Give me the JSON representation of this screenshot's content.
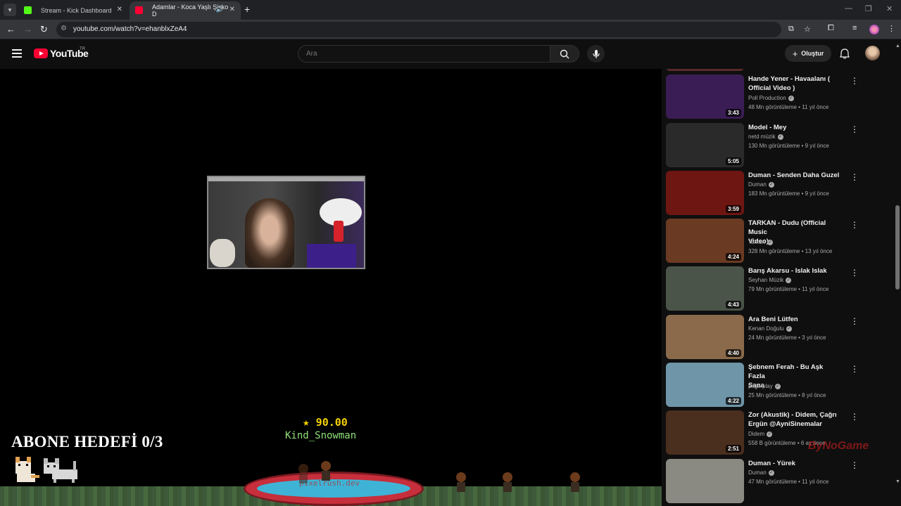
{
  "browser": {
    "tabs": [
      {
        "title": "Stream - Kick Dashboard"
      },
      {
        "title": "Adamlar - Koca Yaşlı Şişko D"
      }
    ],
    "url": "youtube.com/watch?v=ehanblxZeA4"
  },
  "masthead": {
    "logo_text": "YouTube",
    "country_code": "TR",
    "search_placeholder": "Ara",
    "create_label": "Oluştur"
  },
  "stream": {
    "subscriber_goal": "ABONE HEDEFİ 0/3",
    "donation_amount": "90.00",
    "donation_user": "Kind_Snowman",
    "pool_label": "pixelrush.dev"
  },
  "recommendations": [
    {
      "title_1": "Hande Yener - Havaalanı (",
      "title_2": "Official Video )",
      "channel": "Poll Production",
      "meta": "48 Mn görüntüleme • 11 yıl önce",
      "duration": "3:43",
      "thumb_color": "#3a1d55"
    },
    {
      "title_1": "Model - Mey",
      "title_2": "",
      "channel": "netd müzik",
      "meta": "130 Mn görüntüleme • 9 yıl önce",
      "duration": "5:05",
      "thumb_color": "#2a2a2a"
    },
    {
      "title_1": "Duman - Senden Daha Guzel",
      "title_2": "",
      "channel": "Duman",
      "meta": "183 Mn görüntüleme • 9 yıl önce",
      "duration": "3:59",
      "thumb_color": "#6e1612"
    },
    {
      "title_1": "TARKAN - Dudu (Official Music",
      "title_2": "Video)",
      "channel": "Tarkan",
      "meta": "328 Mn görüntüleme • 13 yıl önce",
      "duration": "4:24",
      "thumb_color": "#6b3a22"
    },
    {
      "title_1": "Barış Akarsu - Islak Islak",
      "title_2": "",
      "channel": "Seyhan Müzik",
      "meta": "79 Mn görüntüleme • 11 yıl önce",
      "duration": "4:43",
      "thumb_color": "#4a5448"
    },
    {
      "title_1": "Ara Beni Lütfen",
      "title_2": "",
      "channel": "Kenan Doğulu",
      "meta": "24 Mn görüntüleme • 3 yıl önce",
      "duration": "4:40",
      "thumb_color": "#8a6a4a"
    },
    {
      "title_1": "Şebnem Ferah - Bu Aşk Fazla",
      "title_2": "Sana",
      "channel": "paga play",
      "meta": "25 Mn görüntüleme • 8 yıl önce",
      "duration": "4:22",
      "thumb_color": "#6f95a8"
    },
    {
      "title_1": "Zor (Akustik) - Didem, Çağrı",
      "title_2": "Ergün @AyniSinemalar",
      "channel": "Didem",
      "meta": "558 B görüntüleme • 6 ay önce",
      "duration": "2:51",
      "thumb_color": "#4a2e1e"
    },
    {
      "title_1": "Duman - Yürek",
      "title_2": "",
      "channel": "Duman",
      "meta": "47 Mn görüntüleme • 11 yıl önce",
      "duration": "",
      "thumb_color": "#8a8a82"
    }
  ],
  "overlay_watermark": "ByNoGame"
}
